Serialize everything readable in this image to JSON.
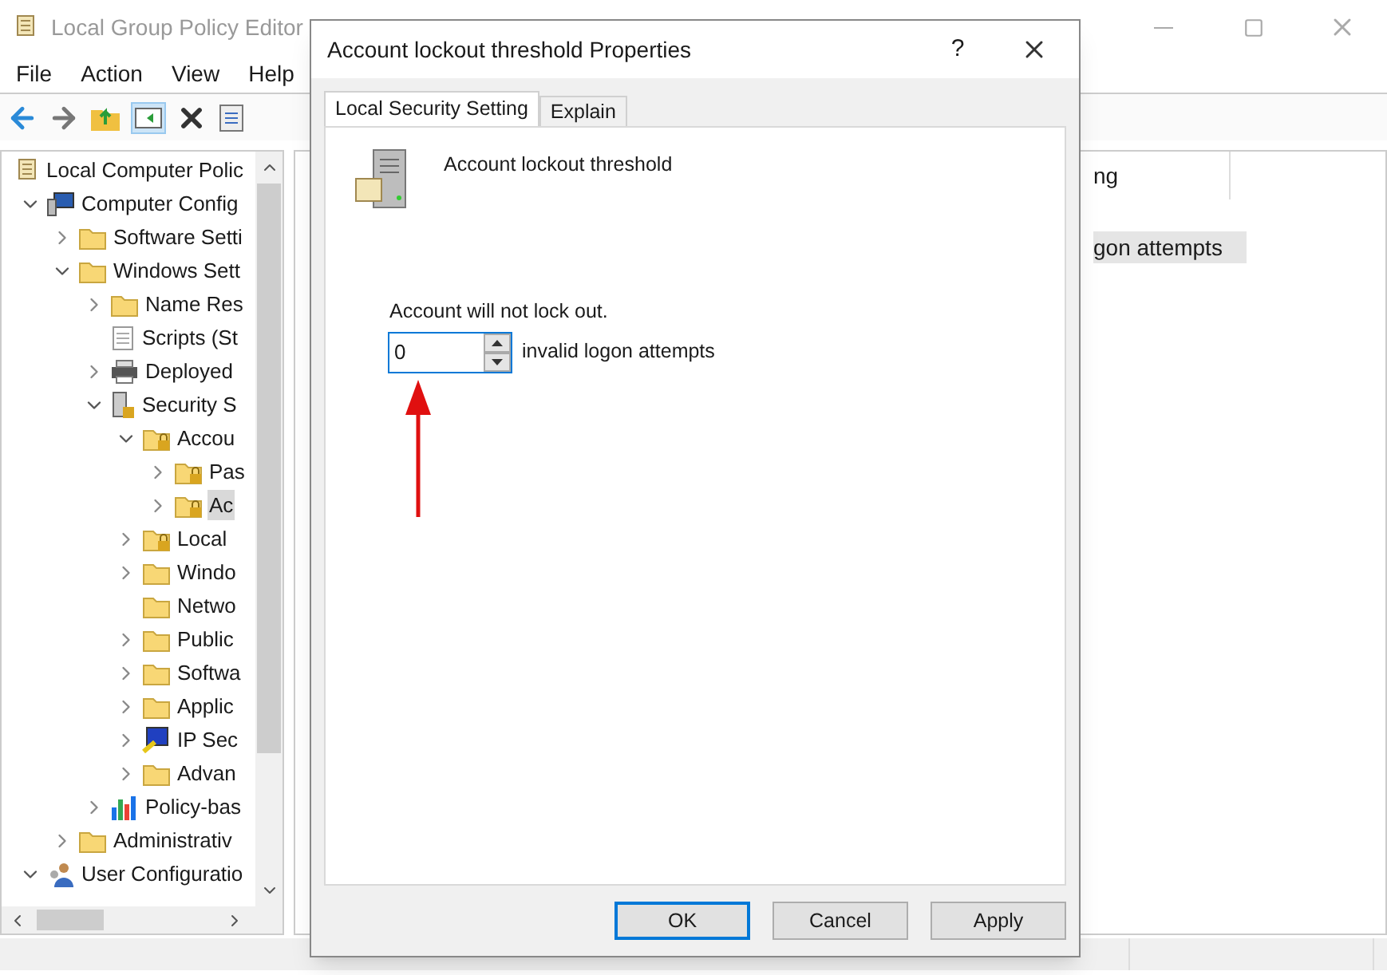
{
  "window": {
    "title": "Local Group Policy Editor"
  },
  "menu": [
    "File",
    "Action",
    "View",
    "Help"
  ],
  "tree": [
    {
      "label": "Local Computer Polic",
      "kind": "scroll",
      "selected": false,
      "children": [
        {
          "label": "Computer Config",
          "kind": "computer",
          "expanded": true,
          "selected": false,
          "children": [
            {
              "label": "Software Setti",
              "kind": "folder",
              "expanded": false,
              "selected": false
            },
            {
              "label": "Windows Sett",
              "kind": "folder",
              "expanded": true,
              "selected": false,
              "children": [
                {
                  "label": "Name Res",
                  "kind": "folder",
                  "expanded": false,
                  "selected": false
                },
                {
                  "label": "Scripts (St",
                  "kind": "script",
                  "selected": false
                },
                {
                  "label": "Deployed",
                  "kind": "printer",
                  "expanded": false,
                  "selected": false
                },
                {
                  "label": "Security S",
                  "kind": "server",
                  "expanded": true,
                  "selected": false,
                  "children": [
                    {
                      "label": "Accou",
                      "kind": "locked-folder",
                      "expanded": true,
                      "selected": false,
                      "children": [
                        {
                          "label": "Pas",
                          "kind": "locked-folder",
                          "expanded": false,
                          "selected": false
                        },
                        {
                          "label": "Ac",
                          "kind": "locked-folder",
                          "expanded": false,
                          "selected": true
                        }
                      ]
                    },
                    {
                      "label": "Local",
                      "kind": "locked-folder",
                      "expanded": false,
                      "selected": false
                    },
                    {
                      "label": "Windo",
                      "kind": "folder",
                      "expanded": false,
                      "selected": false
                    },
                    {
                      "label": "Netwo",
                      "kind": "folder",
                      "selected": false
                    },
                    {
                      "label": "Public",
                      "kind": "folder",
                      "expanded": false,
                      "selected": false
                    },
                    {
                      "label": "Softwa",
                      "kind": "folder",
                      "expanded": false,
                      "selected": false
                    },
                    {
                      "label": "Applic",
                      "kind": "folder",
                      "expanded": false,
                      "selected": false
                    },
                    {
                      "label": "IP Sec",
                      "kind": "network-key",
                      "expanded": false,
                      "selected": false
                    },
                    {
                      "label": "Advan",
                      "kind": "folder",
                      "expanded": false,
                      "selected": false
                    }
                  ]
                },
                {
                  "label": "Policy-bas",
                  "kind": "chart",
                  "expanded": false,
                  "selected": false
                }
              ]
            },
            {
              "label": "Administrativ",
              "kind": "folder",
              "expanded": false,
              "selected": false
            }
          ]
        },
        {
          "label": "User Configuratio",
          "kind": "user",
          "expanded": true,
          "selected": false
        }
      ]
    }
  ],
  "details": {
    "column_2": "ng",
    "rows": [
      {
        "cell": "gon attempts",
        "selected": true
      }
    ]
  },
  "dialog": {
    "title": "Account lockout threshold Properties",
    "help": "?",
    "tabs": [
      {
        "label": "Local Security Setting",
        "selected": true
      },
      {
        "label": "Explain",
        "selected": false
      }
    ],
    "policy_name": "Account lockout threshold",
    "status": "Account will not lock out.",
    "threshold": {
      "value": "0",
      "unit": "invalid logon attempts"
    },
    "buttons": [
      {
        "label": "OK",
        "default": true
      },
      {
        "label": "Cancel",
        "default": false
      },
      {
        "label": "Apply",
        "default": false
      }
    ]
  }
}
